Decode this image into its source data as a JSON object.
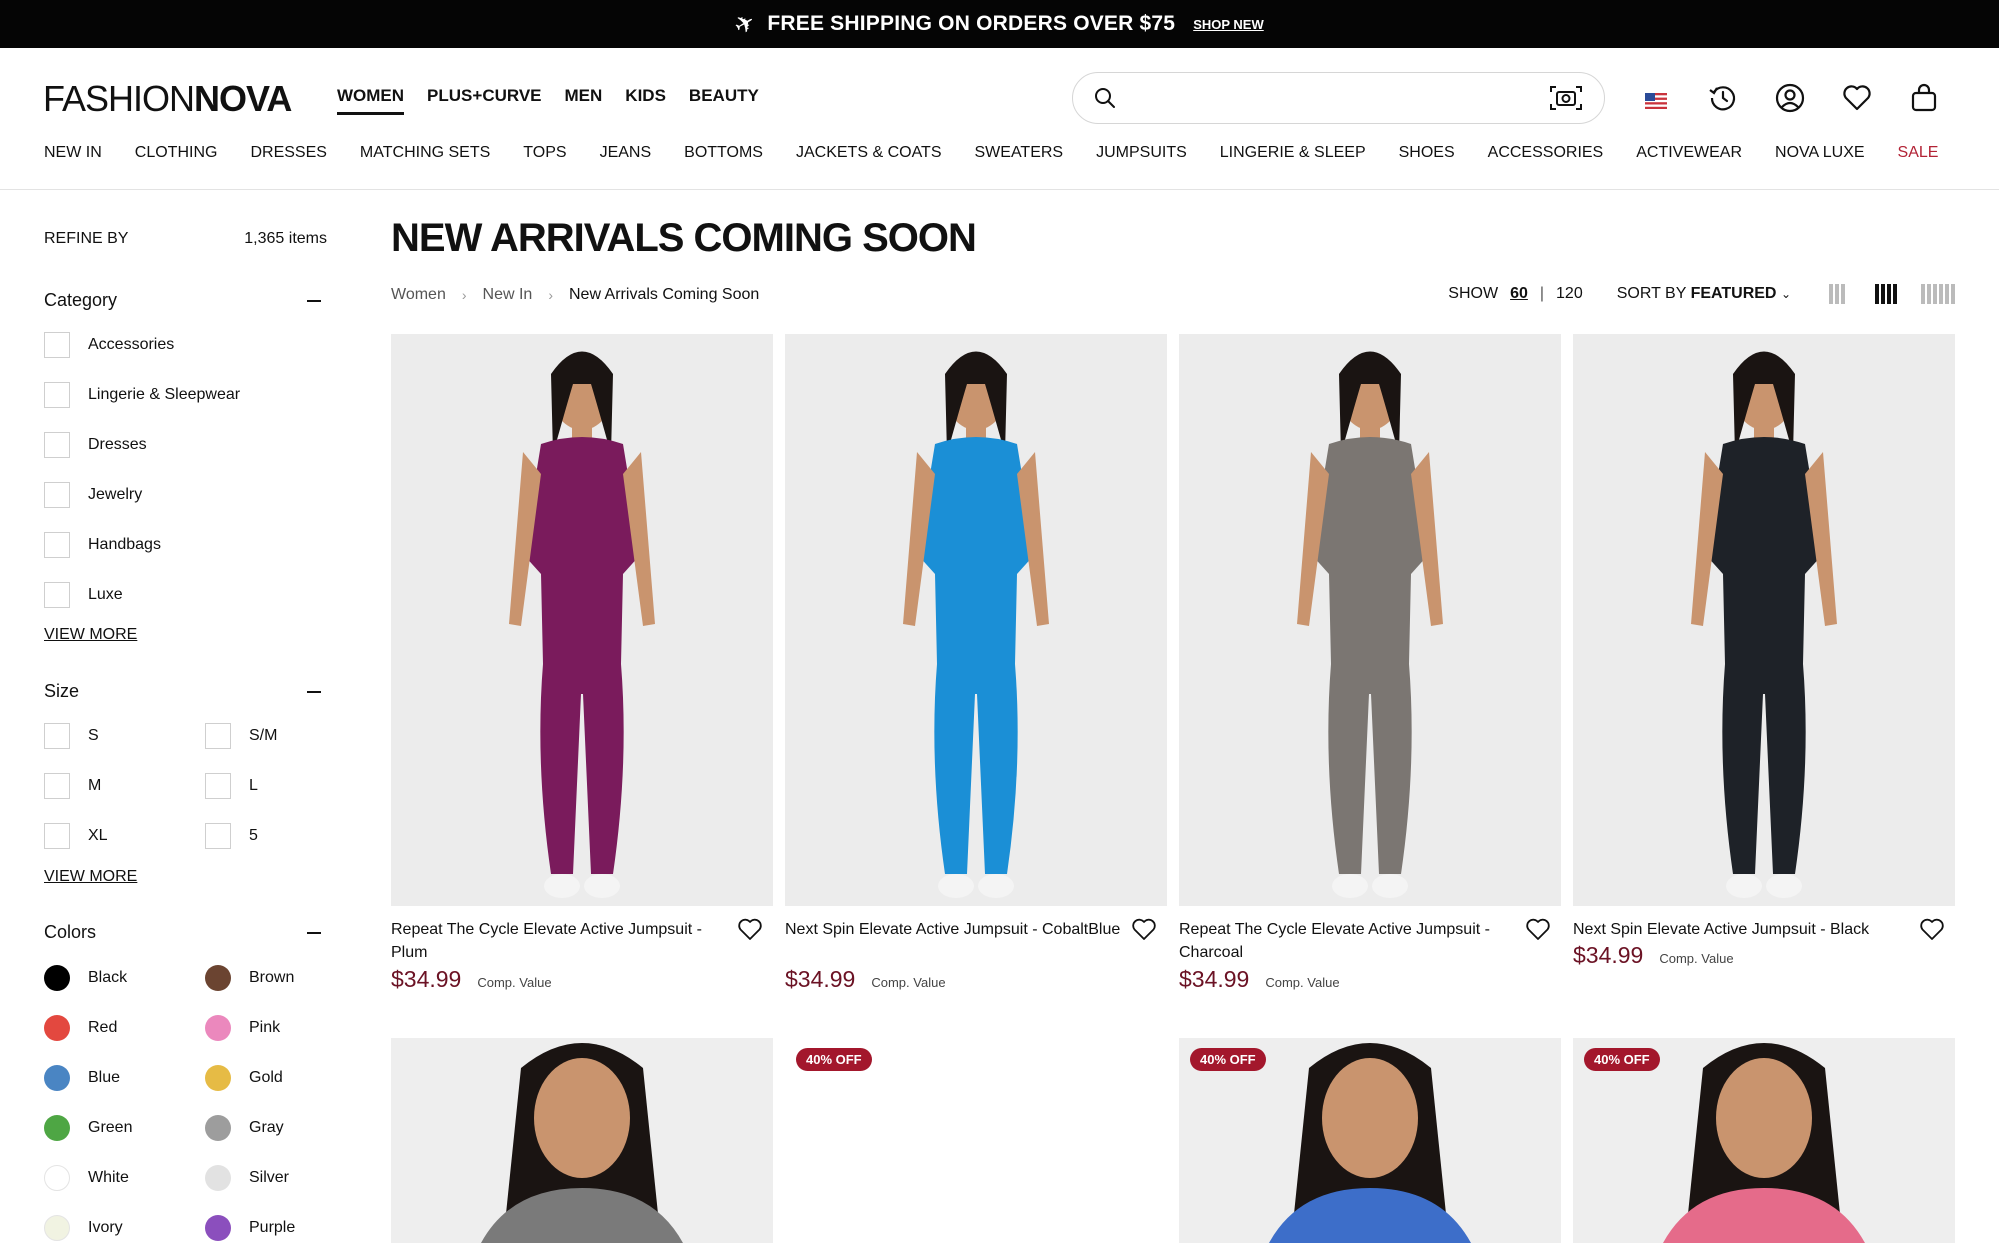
{
  "promo": {
    "message": "FREE SHIPPING ON ORDERS OVER $75",
    "cta": "SHOP NEW"
  },
  "header": {
    "logo_part1": "FASHION",
    "logo_part2": "NOVA",
    "departments": [
      "WOMEN",
      "PLUS+CURVE",
      "MEN",
      "KIDS",
      "BEAUTY"
    ],
    "active_department": "WOMEN",
    "search_placeholder": "",
    "icons": [
      "search-icon",
      "camera-search-icon",
      "us-flag-icon",
      "history-icon",
      "account-icon",
      "wishlist-icon",
      "bag-icon"
    ],
    "categories": [
      "NEW IN",
      "CLOTHING",
      "DRESSES",
      "MATCHING SETS",
      "TOPS",
      "JEANS",
      "BOTTOMS",
      "JACKETS & COATS",
      "SWEATERS",
      "JUMPSUITS",
      "LINGERIE & SLEEP",
      "SHOES",
      "ACCESSORIES",
      "ACTIVEWEAR",
      "NOVA LUXE",
      "SALE"
    ]
  },
  "sidebar": {
    "refine_label": "REFINE BY",
    "item_count": "1,365 items",
    "category": {
      "title": "Category",
      "options": [
        "Accessories",
        "Lingerie & Sleepwear",
        "Dresses",
        "Jewelry",
        "Handbags",
        "Luxe"
      ],
      "view_more": "VIEW MORE"
    },
    "size": {
      "title": "Size",
      "options": [
        "S",
        "S/M",
        "M",
        "L",
        "XL",
        "5"
      ],
      "view_more": "VIEW MORE"
    },
    "colors": {
      "title": "Colors",
      "options": [
        {
          "name": "Black",
          "hex": "#000000"
        },
        {
          "name": "Brown",
          "hex": "#6b4431"
        },
        {
          "name": "Red",
          "hex": "#e3483f"
        },
        {
          "name": "Pink",
          "hex": "#eb88bd"
        },
        {
          "name": "Blue",
          "hex": "#4a85c3"
        },
        {
          "name": "Gold",
          "hex": "#e6bb45"
        },
        {
          "name": "Green",
          "hex": "#4ea644"
        },
        {
          "name": "Gray",
          "hex": "#9d9d9d"
        },
        {
          "name": "White",
          "hex": "#ffffff"
        },
        {
          "name": "Silver",
          "hex": "#e2e2e2"
        },
        {
          "name": "Ivory",
          "hex": "#f1f3e2"
        },
        {
          "name": "Purple",
          "hex": "#8b4fbd"
        }
      ]
    }
  },
  "main": {
    "title": "NEW ARRIVALS COMING SOON",
    "breadcrumb": [
      "Women",
      "New In",
      "New Arrivals Coming Soon"
    ],
    "show_label": "SHOW",
    "show_options": [
      "60",
      "120"
    ],
    "show_selected": "60",
    "sort_label": "SORT BY",
    "sort_value": "FEATURED",
    "grid_options": [
      "3-column",
      "4-column",
      "6-column"
    ],
    "grid_selected": "4-column",
    "products": [
      {
        "name": "Repeat The Cycle Elevate Active Jumpsuit - Plum",
        "price": "$34.99",
        "comp": "Comp. Value",
        "color": "#7a1b5c"
      },
      {
        "name": "Next Spin Elevate Active Jumpsuit - CobaltBlue",
        "price": "$34.99",
        "comp": "Comp. Value",
        "color": "#1b8fd6"
      },
      {
        "name": "Repeat The Cycle Elevate Active Jumpsuit - Charcoal",
        "price": "$34.99",
        "comp": "Comp. Value",
        "color": "#7b7672"
      },
      {
        "name": "Next Spin Elevate Active Jumpsuit - Black",
        "price": "$34.99",
        "comp": "Comp. Value",
        "color": "#1e2228"
      }
    ],
    "row2": [
      {
        "badge": "",
        "color": "#7a7a7a"
      },
      {
        "badge": "40% OFF",
        "color": "#ffffff"
      },
      {
        "badge": "40% OFF",
        "color": "#3d6ec9"
      },
      {
        "badge": "40% OFF",
        "color": "#e56b8a"
      }
    ]
  }
}
